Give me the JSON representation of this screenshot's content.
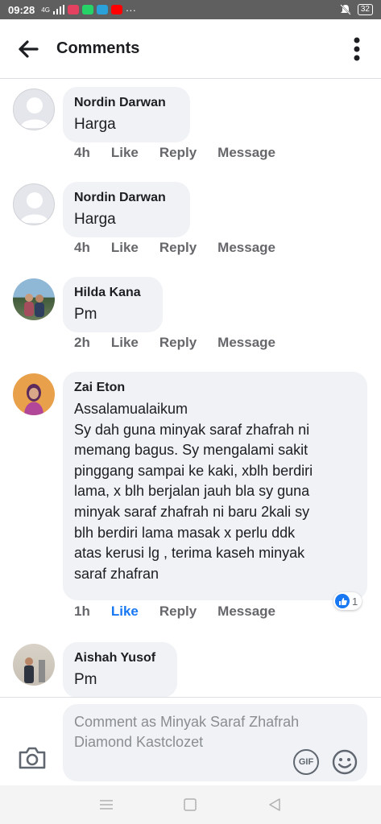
{
  "status_bar": {
    "time": "09:28",
    "network": "4G",
    "battery": "32"
  },
  "header": {
    "title": "Comments"
  },
  "comments": [
    {
      "author": "Nordin Darwan",
      "text": "Harga",
      "time": "4h",
      "like": "Like",
      "reply": "Reply",
      "message": "Message",
      "avatar": "default-avatar"
    },
    {
      "author": "Nordin Darwan",
      "text": "Harga",
      "time": "4h",
      "like": "Like",
      "reply": "Reply",
      "message": "Message",
      "avatar": "default-avatar"
    },
    {
      "author": "Hilda Kana",
      "text": "Pm",
      "time": "2h",
      "like": "Like",
      "reply": "Reply",
      "message": "Message",
      "avatar": "photo-avatar"
    },
    {
      "author": "Zai Eton",
      "text": "Assalamualaikum\nSy dah guna minyak saraf zhafrah ni\nmemang bagus. Sy mengalami sakit\npinggang sampai ke kaki, xblh berdiri\nlama, x blh berjalan jauh bla sy guna\nminyak saraf zhafrah ni baru 2kali sy\nblh berdiri lama masak x perlu ddk\natas kerusi lg , terima kaseh minyak\nsaraf zhafran",
      "time": "1h",
      "like": "Like",
      "reply": "Reply",
      "message": "Message",
      "avatar": "photo-avatar",
      "reaction_count": "1",
      "liked": true
    },
    {
      "author": "Aishah Yusof",
      "text": "Pm",
      "avatar": "photo-avatar"
    }
  ],
  "composer": {
    "placeholder": "Comment as Minyak Saraf Zhafrah Diamond Kastclozet",
    "gif_label": "GIF"
  },
  "colors": {
    "accent": "#1877f2",
    "bubble": "#f0f2f5",
    "muted_text": "#65676b"
  }
}
